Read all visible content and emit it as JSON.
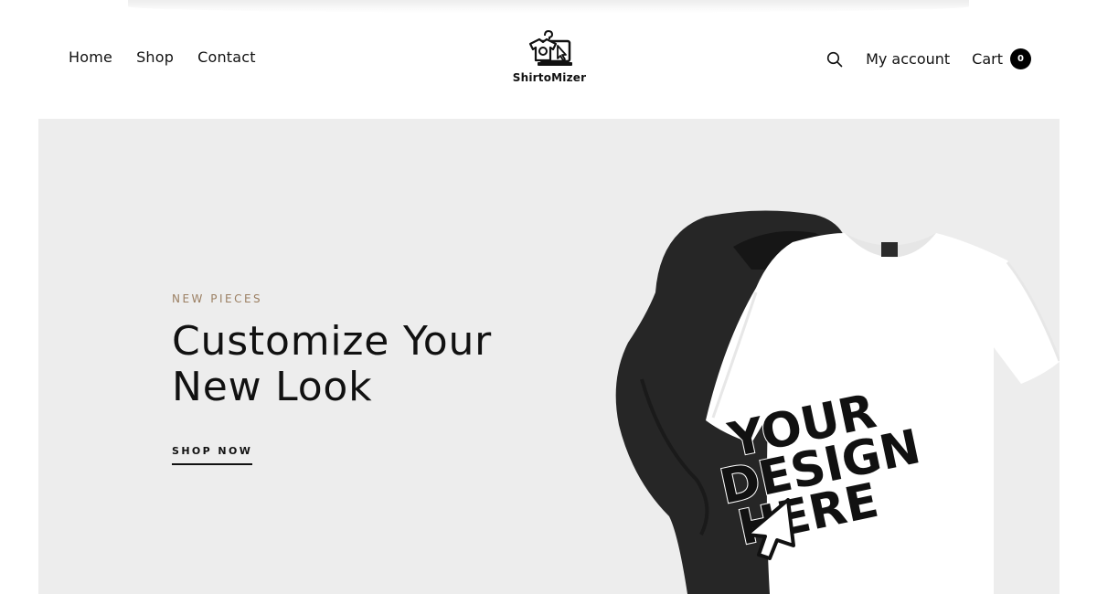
{
  "header": {
    "nav_left": [
      {
        "label": "Home"
      },
      {
        "label": "Shop"
      },
      {
        "label": "Contact"
      }
    ],
    "logo_text": "ShirtoMizer",
    "my_account_label": "My account",
    "cart_label": "Cart",
    "cart_count": "0",
    "search_icon": "search-icon"
  },
  "hero": {
    "kicker": "NEW PIECES",
    "headline": "Customize Your New Look",
    "cta_label": "SHOP NOW",
    "artwork": {
      "shirt_print_lines": [
        "YOUR",
        "DESIGN",
        "HERE"
      ]
    }
  },
  "colors": {
    "hero_bg": "#ededed",
    "kicker": "#9b7f62",
    "text": "#111111",
    "badge_bg": "#000000"
  }
}
